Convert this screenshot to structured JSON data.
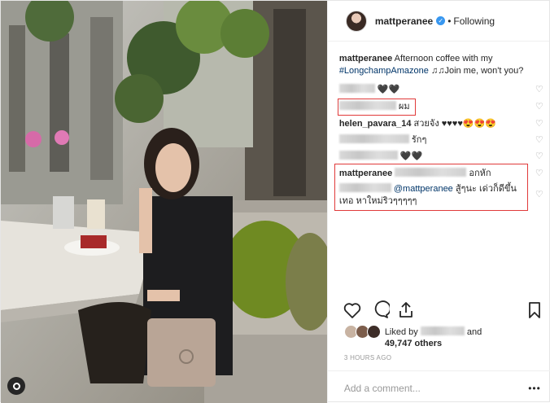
{
  "header": {
    "username": "mattperanee",
    "verified_mark": "✓",
    "separator": "•",
    "follow_state": "Following"
  },
  "caption": {
    "username": "mattperanee",
    "text_1": " Afternoon coffee with my ",
    "hashtag": "#LongchampAmazone",
    "text_2": " ♫♫Join me, won't you?"
  },
  "comments": [
    {
      "text": "🖤🖤"
    },
    {
      "text": "ผม"
    },
    {
      "username": "helen_pavara_14",
      "text": " สวยจัง ♥♥♥♥😍😍😍"
    },
    {
      "text": "รักๆ"
    },
    {
      "text": "🖤🖤"
    },
    {
      "username": "mattperanee",
      "text": "อกหัก"
    },
    {
      "mention": "@mattperanee",
      "text": " สู้ๆนะ เด่วก็ดีขึ้นเทอ หาใหม่ริวๆๆๆๆๆ"
    }
  ],
  "likes": {
    "prefix": "Liked by",
    "suffix": "and",
    "others": "49,747 others"
  },
  "time": "3 HOURS AGO",
  "add_comment": {
    "placeholder": "Add a comment...",
    "more": "•••"
  },
  "icons": {
    "heart": "heart-icon",
    "comment": "comment-icon",
    "share": "share-icon",
    "bookmark": "bookmark-icon"
  },
  "colors": {
    "highlight_box": "#e03a3a",
    "link": "#003569",
    "verified": "#3897f0"
  }
}
